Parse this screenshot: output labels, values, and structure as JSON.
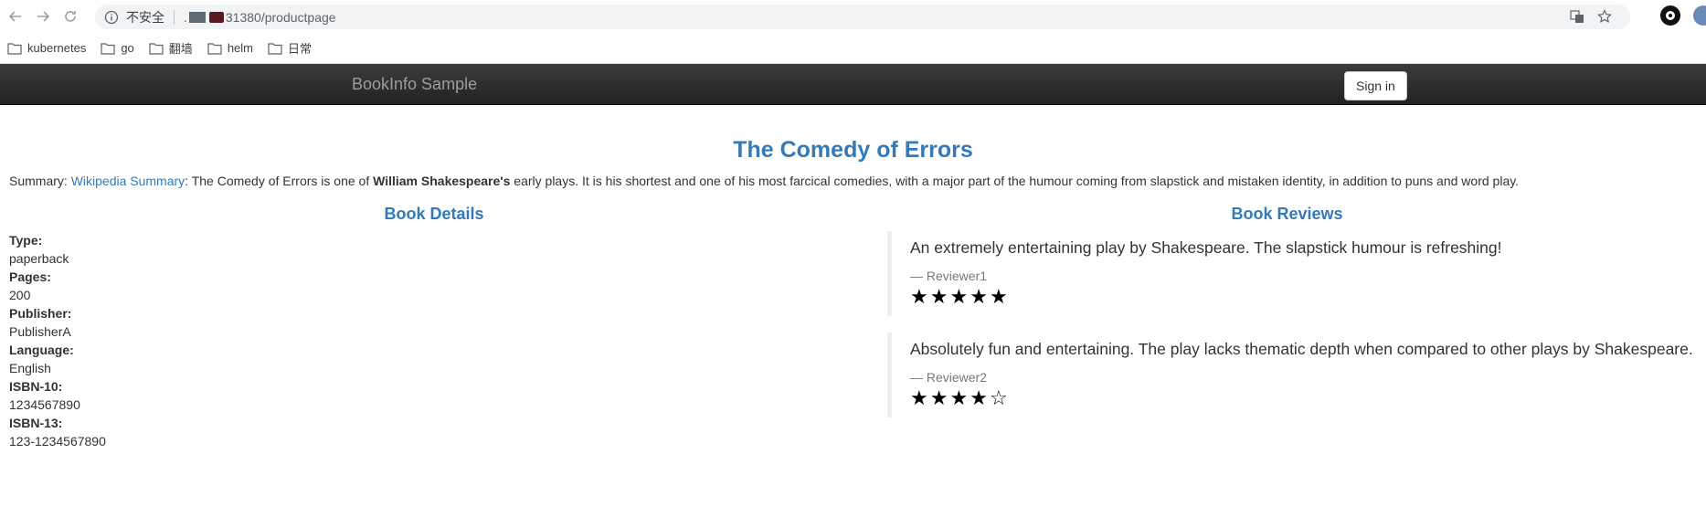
{
  "browser": {
    "insecure_label": "不安全",
    "url_prefix": ".",
    "url_suffix": "31380/productpage",
    "bookmarks": [
      "kubernetes",
      "go",
      "翻墙",
      "helm",
      "日常"
    ]
  },
  "navbar": {
    "brand": "BookInfo Sample",
    "signin_label": "Sign in"
  },
  "book": {
    "title": "The Comedy of Errors",
    "summary_prefix": "Summary: ",
    "summary_link": "Wikipedia Summary",
    "summary_text1": ": The Comedy of Errors is one of ",
    "summary_bold": "William Shakespeare's",
    "summary_text2": " early plays. It is his shortest and one of his most farcical comedies, with a major part of the humour coming from slapstick and mistaken identity, in addition to puns and word play."
  },
  "details": {
    "heading": "Book Details",
    "fields": [
      {
        "label": "Type:",
        "value": "paperback"
      },
      {
        "label": "Pages:",
        "value": "200"
      },
      {
        "label": "Publisher:",
        "value": "PublisherA"
      },
      {
        "label": "Language:",
        "value": "English"
      },
      {
        "label": "ISBN-10:",
        "value": "1234567890"
      },
      {
        "label": "ISBN-13:",
        "value": "123-1234567890"
      }
    ]
  },
  "reviews": {
    "heading": "Book Reviews",
    "items": [
      {
        "text": "An extremely entertaining play by Shakespeare. The slapstick humour is refreshing!",
        "author": "— Reviewer1",
        "rating": 5,
        "max": 5
      },
      {
        "text": "Absolutely fun and entertaining. The play lacks thematic depth when compared to other plays by Shakespeare.",
        "author": "— Reviewer2",
        "rating": 4,
        "max": 5
      }
    ]
  }
}
